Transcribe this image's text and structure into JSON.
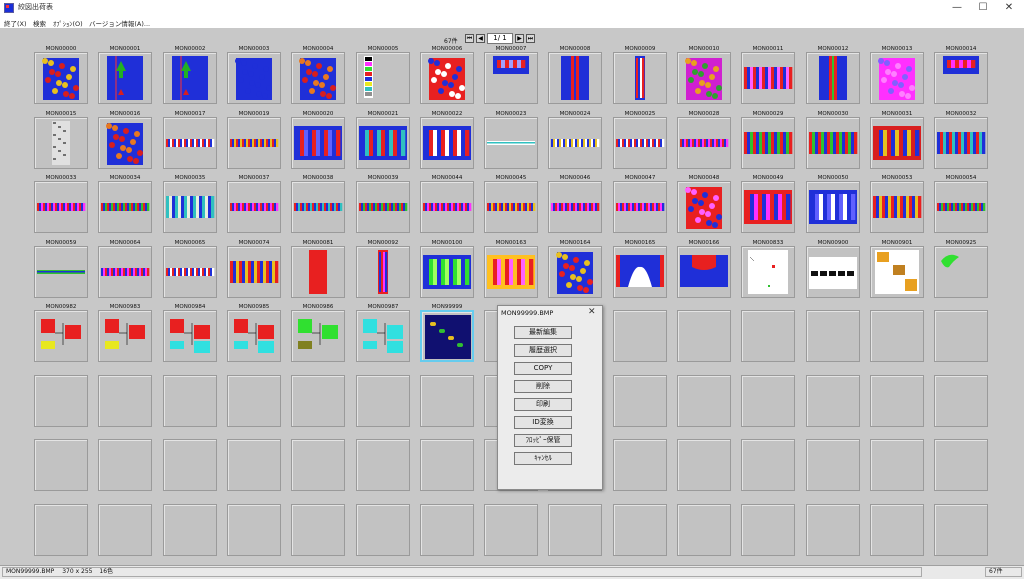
{
  "window": {
    "title": "絞図出荷表",
    "minimize_glyph": "—",
    "maximize_glyph": "☐",
    "close_glyph": "✕"
  },
  "menu": [
    "終了(X)",
    "検索",
    "ｵﾌﾟｼｮﾝ(O)",
    "バージョン情報(A)..."
  ],
  "nav": {
    "count": "67件",
    "page": "1/ 1",
    "first_glyph": "⏮",
    "prev_glyph": "◀",
    "next_glyph": "▶",
    "last_glyph": "⏭"
  },
  "thumbnails": [
    {
      "id": "MON00000",
      "kind": "full",
      "c": [
        "#1f2fd8",
        "#d81e1e",
        "#e8c020"
      ]
    },
    {
      "id": "MON00001",
      "kind": "arrow",
      "c": [
        "#1f2fd8",
        "#22b022",
        "#d81e1e"
      ]
    },
    {
      "id": "MON00002",
      "kind": "arrow",
      "c": [
        "#1f2fd8",
        "#22b022",
        "#d81e1e"
      ]
    },
    {
      "id": "MON00003",
      "kind": "full",
      "c": [
        "#1f2fd8",
        "#1f2fd8",
        "#1f2fd8"
      ]
    },
    {
      "id": "MON00004",
      "kind": "full",
      "c": [
        "#1f2fd8",
        "#d81e1e",
        "#e87820"
      ]
    },
    {
      "id": "MON00005",
      "kind": "palette",
      "c": [
        "#000000",
        "#ff30ff",
        "#30e030"
      ]
    },
    {
      "id": "MON00006",
      "kind": "full",
      "c": [
        "#e82020",
        "#ffffff",
        "#1f2fd8"
      ]
    },
    {
      "id": "MON00007",
      "kind": "top",
      "c": [
        "#1f2fd8",
        "#e82020",
        "#a0a0ff"
      ]
    },
    {
      "id": "MON00008",
      "kind": "vstrip",
      "c": [
        "#1f2fd8",
        "#e82020",
        "#1f2fd8"
      ]
    },
    {
      "id": "MON00009",
      "kind": "narrow",
      "c": [
        "#1f2fd8",
        "#e82020",
        "#ffffff"
      ]
    },
    {
      "id": "MON00010",
      "kind": "full",
      "c": [
        "#d020d0",
        "#30a030",
        "#e8a020"
      ]
    },
    {
      "id": "MON00011",
      "kind": "hband",
      "c": [
        "#e82020",
        "#1f2fd8",
        "#ff60ff"
      ]
    },
    {
      "id": "MON00012",
      "kind": "vstrip",
      "c": [
        "#1f2fd8",
        "#e82020",
        "#30c030"
      ]
    },
    {
      "id": "MON00013",
      "kind": "full",
      "c": [
        "#ff30ff",
        "#ff80ff",
        "#8060ff"
      ]
    },
    {
      "id": "MON00014",
      "kind": "top",
      "c": [
        "#1f2fd8",
        "#e82020",
        "#ff30ff"
      ]
    },
    {
      "id": "MON00015",
      "kind": "narrowfull",
      "c": [
        "#e0e0e0",
        "#707070",
        "#ffffff"
      ]
    },
    {
      "id": "MON00016",
      "kind": "full",
      "c": [
        "#1f2fd8",
        "#d81e1e",
        "#e87820"
      ]
    },
    {
      "id": "MON00017",
      "kind": "thin",
      "c": [
        "#e82020",
        "#1f2fd8",
        "#ffffff"
      ]
    },
    {
      "id": "MON00019",
      "kind": "thin",
      "c": [
        "#e82020",
        "#1f2fd8",
        "#e8c020"
      ]
    },
    {
      "id": "MON00020",
      "kind": "wide",
      "c": [
        "#1f2fd8",
        "#e82020",
        "#6060ff"
      ]
    },
    {
      "id": "MON00021",
      "kind": "wide",
      "c": [
        "#1f2fd8",
        "#30c0c0",
        "#e82020"
      ]
    },
    {
      "id": "MON00022",
      "kind": "wide",
      "c": [
        "#1f2fd8",
        "#e82020",
        "#ffffff"
      ]
    },
    {
      "id": "MON00023",
      "kind": "line",
      "c": [
        "#ffffff",
        "#30c0c0",
        "#909090"
      ]
    },
    {
      "id": "MON00024",
      "kind": "thin",
      "c": [
        "#1f2fd8",
        "#e8c020",
        "#ffffff"
      ]
    },
    {
      "id": "MON00025",
      "kind": "thin",
      "c": [
        "#e82020",
        "#1f2fd8",
        "#ffffff"
      ]
    },
    {
      "id": "MON00028",
      "kind": "thin",
      "c": [
        "#e82020",
        "#1f2fd8",
        "#ff30ff"
      ]
    },
    {
      "id": "MON00029",
      "kind": "hband",
      "c": [
        "#e82020",
        "#1f2fd8",
        "#30c030"
      ]
    },
    {
      "id": "MON00030",
      "kind": "hband",
      "c": [
        "#e82020",
        "#30c030",
        "#1f2fd8"
      ]
    },
    {
      "id": "MON00031",
      "kind": "wide",
      "c": [
        "#d81e1e",
        "#1f2fd8",
        "#e8c020"
      ]
    },
    {
      "id": "MON00032",
      "kind": "hband",
      "c": [
        "#1f2fd8",
        "#e82020",
        "#30c0c0"
      ]
    },
    {
      "id": "MON00033",
      "kind": "thin",
      "c": [
        "#e82020",
        "#1f2fd8",
        "#ff30ff"
      ]
    },
    {
      "id": "MON00034",
      "kind": "thin",
      "c": [
        "#e82020",
        "#1f2fd8",
        "#30c030"
      ]
    },
    {
      "id": "MON00035",
      "kind": "hband",
      "c": [
        "#30c0c0",
        "#e8f0e0",
        "#1f2fd8"
      ]
    },
    {
      "id": "MON00037",
      "kind": "thin",
      "c": [
        "#e82020",
        "#1f2fd8",
        "#ff30ff"
      ]
    },
    {
      "id": "MON00038",
      "kind": "thin",
      "c": [
        "#e82020",
        "#1f2fd8",
        "#30c0c0"
      ]
    },
    {
      "id": "MON00039",
      "kind": "thin",
      "c": [
        "#e82020",
        "#1f2fd8",
        "#30c030"
      ]
    },
    {
      "id": "MON00044",
      "kind": "thin",
      "c": [
        "#e82020",
        "#1f2fd8",
        "#ff30ff"
      ]
    },
    {
      "id": "MON00045",
      "kind": "thin",
      "c": [
        "#e82020",
        "#1f2fd8",
        "#e8c020"
      ]
    },
    {
      "id": "MON00046",
      "kind": "thin",
      "c": [
        "#ff30ff",
        "#1f2fd8",
        "#e82020"
      ]
    },
    {
      "id": "MON00047",
      "kind": "thin",
      "c": [
        "#e82020",
        "#ff30ff",
        "#1f2fd8"
      ]
    },
    {
      "id": "MON00048",
      "kind": "full",
      "c": [
        "#e82020",
        "#1f2fd8",
        "#ff60ff"
      ]
    },
    {
      "id": "MON00049",
      "kind": "wide",
      "c": [
        "#e82020",
        "#1f2fd8",
        "#ff30ff"
      ]
    },
    {
      "id": "MON00050",
      "kind": "wide",
      "c": [
        "#1f2fd8",
        "#6060ff",
        "#ffffff"
      ]
    },
    {
      "id": "MON00053",
      "kind": "hband",
      "c": [
        "#e82020",
        "#1f2fd8",
        "#e8c020"
      ]
    },
    {
      "id": "MON00054",
      "kind": "thin",
      "c": [
        "#e82020",
        "#1f2fd8",
        "#30c030"
      ]
    },
    {
      "id": "MON00059",
      "kind": "line",
      "c": [
        "#30c030",
        "#1f2fd8",
        "#e82020"
      ]
    },
    {
      "id": "MON00064",
      "kind": "thin",
      "c": [
        "#1f2fd8",
        "#ff30ff",
        "#e82020"
      ]
    },
    {
      "id": "MON00065",
      "kind": "thin",
      "c": [
        "#e82020",
        "#1f2fd8",
        "#ffffff"
      ]
    },
    {
      "id": "MON00074",
      "kind": "hband",
      "c": [
        "#e82020",
        "#1f2fd8",
        "#e8c020"
      ]
    },
    {
      "id": "MON00081",
      "kind": "narrowfull",
      "c": [
        "#e82020",
        "#e82020",
        "#e82020"
      ]
    },
    {
      "id": "MON00092",
      "kind": "narrow",
      "c": [
        "#e82020",
        "#1f2fd8",
        "#ff30ff"
      ]
    },
    {
      "id": "MON00100",
      "kind": "wide",
      "c": [
        "#1f2fd8",
        "#30e030",
        "#a0ff60"
      ]
    },
    {
      "id": "MON00163",
      "kind": "wide",
      "c": [
        "#ffc020",
        "#e82020",
        "#ff60ff"
      ]
    },
    {
      "id": "MON00164",
      "kind": "full",
      "c": [
        "#1f2fd8",
        "#e82020",
        "#e8c020"
      ]
    },
    {
      "id": "MON00165",
      "kind": "curtain",
      "c": [
        "#1f2fd8",
        "#e82020",
        "#ffffff"
      ]
    },
    {
      "id": "MON00166",
      "kind": "curtain2",
      "c": [
        "#1f2fd8",
        "#e82020",
        "#ffffff"
      ]
    },
    {
      "id": "MON00833",
      "kind": "sparse",
      "c": [
        "#ffffff",
        "#e82020",
        "#30c030"
      ]
    },
    {
      "id": "MON00900",
      "kind": "text",
      "c": [
        "#ffffff",
        "#111111",
        "#909090"
      ]
    },
    {
      "id": "MON00901",
      "kind": "blocks",
      "c": [
        "#ffffff",
        "#e8a020",
        "#c08020"
      ]
    },
    {
      "id": "MON00925",
      "kind": "blob",
      "c": [
        "#c2c2c2",
        "#30e030",
        "#30e030"
      ]
    },
    {
      "id": "MON00982",
      "kind": "diagram",
      "c": [
        "#e82020",
        "#e8e820",
        "#000000"
      ]
    },
    {
      "id": "MON00983",
      "kind": "diagram",
      "c": [
        "#e82020",
        "#e8e820",
        "#000000"
      ]
    },
    {
      "id": "MON00984",
      "kind": "diagram2",
      "c": [
        "#e82020",
        "#30e0e0",
        "#000000"
      ]
    },
    {
      "id": "MON00985",
      "kind": "diagram2",
      "c": [
        "#e82020",
        "#30e0e0",
        "#000000"
      ]
    },
    {
      "id": "MON00986",
      "kind": "diagram",
      "c": [
        "#30e030",
        "#808020",
        "#000000"
      ]
    },
    {
      "id": "MON00987",
      "kind": "diagram2",
      "c": [
        "#30e0e0",
        "#30e0e0",
        "#000000"
      ]
    },
    {
      "id": "MON99999",
      "kind": "dark",
      "c": [
        "#101070",
        "#30c030",
        "#e8c020"
      ]
    }
  ],
  "selected_index": 66,
  "context_menu": {
    "title": "MON99999.BMP",
    "close_glyph": "✕",
    "buttons": [
      "最新編集",
      "履歴選択",
      "COPY",
      "削除",
      "印刷",
      "ID変換",
      "ﾌﾛｯﾋﾟｰ保管",
      "ｷｬﾝｾﾙ"
    ]
  },
  "status": {
    "file": "MON99999.BMP",
    "size": "370 x   255",
    "colors": "16色",
    "count": "67件"
  }
}
